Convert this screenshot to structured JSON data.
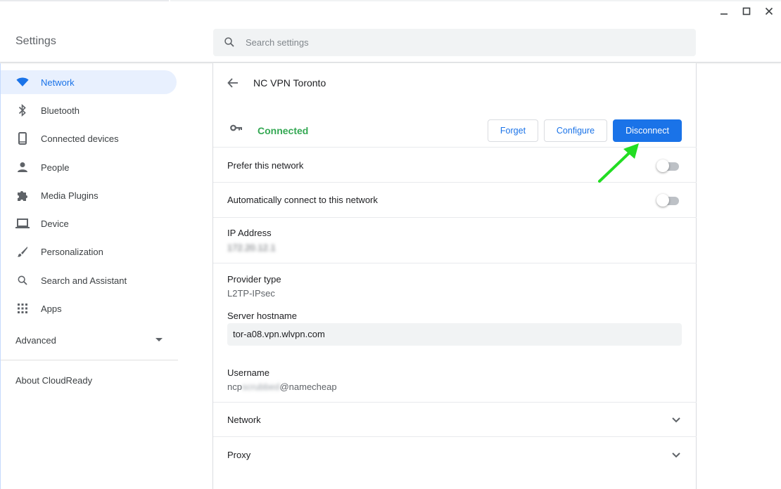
{
  "window": {
    "controls": [
      "minimize",
      "maximize",
      "close"
    ]
  },
  "header": {
    "title": "Settings",
    "search_placeholder": "Search settings",
    "search_icon": "search-icon"
  },
  "sidebar": {
    "items": [
      {
        "label": "Network",
        "icon": "wifi-icon",
        "active": true
      },
      {
        "label": "Bluetooth",
        "icon": "bluetooth-icon"
      },
      {
        "label": "Connected devices",
        "icon": "phone-icon"
      },
      {
        "label": "People",
        "icon": "person-icon"
      },
      {
        "label": "Media Plugins",
        "icon": "puzzle-icon"
      },
      {
        "label": "Device",
        "icon": "laptop-icon"
      },
      {
        "label": "Personalization",
        "icon": "brush-icon"
      },
      {
        "label": "Search and Assistant",
        "icon": "search-icon"
      },
      {
        "label": "Apps",
        "icon": "apps-grid-icon"
      }
    ],
    "advanced_label": "Advanced",
    "about_label": "About CloudReady"
  },
  "detail": {
    "title": "NC VPN Toronto",
    "status": "Connected",
    "status_color": "#34a853",
    "buttons": {
      "forget": "Forget",
      "configure": "Configure",
      "disconnect": "Disconnect"
    },
    "prefer_network": {
      "label": "Prefer this network",
      "on": false
    },
    "auto_connect": {
      "label": "Automatically connect to this network",
      "on": false
    },
    "ip_address": {
      "label": "IP Address",
      "value": "172.20.12.1"
    },
    "provider_type": {
      "label": "Provider type",
      "value": "L2TP-IPsec"
    },
    "server_hostname": {
      "label": "Server hostname",
      "value": "tor-a08.vpn.wlvpn.com"
    },
    "username": {
      "label": "Username",
      "prefix": "ncp",
      "hidden_part": "scrubbed",
      "suffix": "@namecheap"
    },
    "sections": [
      {
        "label": "Network"
      },
      {
        "label": "Proxy"
      }
    ]
  },
  "colors": {
    "accent": "#1a73e8",
    "annotation_arrow": "#22dd22"
  }
}
